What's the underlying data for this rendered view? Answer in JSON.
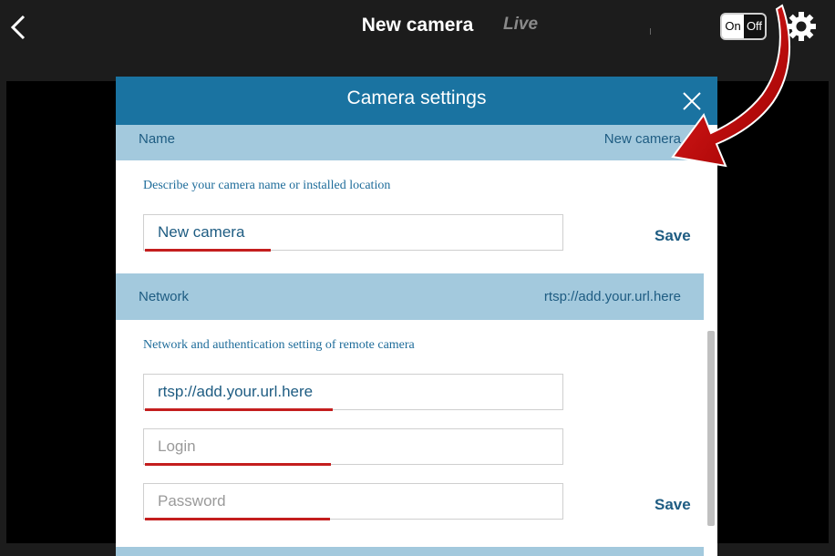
{
  "topbar": {
    "title": "New camera",
    "live_label": "Live",
    "toggle_on": "On",
    "toggle_off": "Off"
  },
  "modal": {
    "title": "Camera settings",
    "name_section": {
      "label": "Name",
      "value": "New camera",
      "description": "Describe your camera name or installed location",
      "input_value": "New camera",
      "save_label": "Save"
    },
    "network_section": {
      "label": "Network",
      "value": "rtsp://add.your.url.here",
      "description": "Network and authentication setting of remote camera",
      "url_value": "rtsp://add.your.url.here",
      "login_placeholder": "Login",
      "password_placeholder": "Password",
      "save_label": "Save"
    }
  },
  "colors": {
    "header_blue": "#1a73a1",
    "section_bar": "#a3c9dd",
    "underline_red": "#c41e1e",
    "arrow_red": "#d10000"
  },
  "icons": [
    "back-chevron-icon",
    "gear-icon",
    "close-icon",
    "annotation-arrow"
  ]
}
